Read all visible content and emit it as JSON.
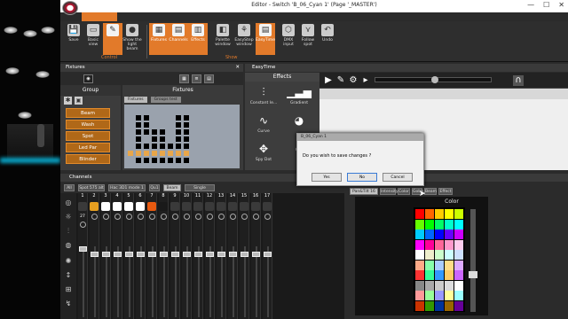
{
  "window": {
    "title": "Editor - Switch 'B_06_Cyan 1' (Page '_MASTER')",
    "home_tab": "",
    "controls": [
      "—",
      "☐",
      "✕"
    ]
  },
  "ribbon": {
    "buttons": [
      {
        "label": "Save",
        "icon": "save-icon",
        "sel": false
      },
      {
        "label": "Basic view",
        "icon": "monitor-icon",
        "sel": false
      },
      {
        "label": "",
        "icon": "edit-icon",
        "sel": true
      },
      {
        "label": "Show the light beam",
        "icon": "bulb-icon",
        "sel": false
      },
      {
        "label": "Fixtures",
        "icon": "fixtures-icon",
        "sel": true
      },
      {
        "label": "Channels",
        "icon": "channels-icon",
        "sel": true
      },
      {
        "label": "Effects",
        "icon": "effects-icon",
        "sel": true
      },
      {
        "label": "Palette window",
        "icon": "palette-icon",
        "sel": false
      },
      {
        "label": "EasyStep window",
        "icon": "easystep-icon",
        "sel": false
      },
      {
        "label": "EasyTime",
        "icon": "easytime-icon",
        "sel": true
      },
      {
        "label": "DMX input",
        "icon": "dmx-input-icon",
        "sel": false
      },
      {
        "label": "Follow spot",
        "icon": "follow-spot-icon",
        "sel": false
      },
      {
        "label": "Undo",
        "icon": "undo-icon",
        "sel": false
      }
    ],
    "groups": [
      "Control",
      "Show"
    ]
  },
  "fixtures": {
    "title": "Fixtures",
    "group_header": "Group",
    "fixtures_header": "Fixtures",
    "tabs": [
      "Fixtures",
      "Groups test"
    ],
    "groups": [
      "Beam",
      "Wash",
      "Spot",
      "Led Par",
      "Blinder"
    ]
  },
  "easytime": {
    "title": "EasyTime"
  },
  "effects": {
    "header": "Effects",
    "items": [
      "Constant le...",
      "Gradient",
      "Curve",
      "",
      "Spy Dot",
      ""
    ]
  },
  "channels": {
    "title": "Channels",
    "tabs": [
      "All",
      "Spot 575 alt",
      "Hac 3D1 mode 1",
      "Qu1",
      "Beam",
      "Single channel"
    ],
    "right_tabs": [
      "Pan&Tilt 16 Bit",
      "Intensity",
      "Color",
      "Gobo",
      "Beam",
      "Effect"
    ],
    "color_label": "Color",
    "value_row": "27",
    "cols": [
      "1",
      "2",
      "3",
      "4",
      "5",
      "6",
      "7",
      "8",
      "9",
      "10",
      "11",
      "12",
      "13",
      "14",
      "15",
      "16",
      "17"
    ]
  },
  "dialog": {
    "title": "B_06_Cyan 1",
    "message": "Do you wish to save changes ?",
    "buttons": [
      "Yes",
      "No",
      "Cancel"
    ]
  },
  "colors": {
    "accent": "#e27a2a",
    "group": "#b06818"
  }
}
